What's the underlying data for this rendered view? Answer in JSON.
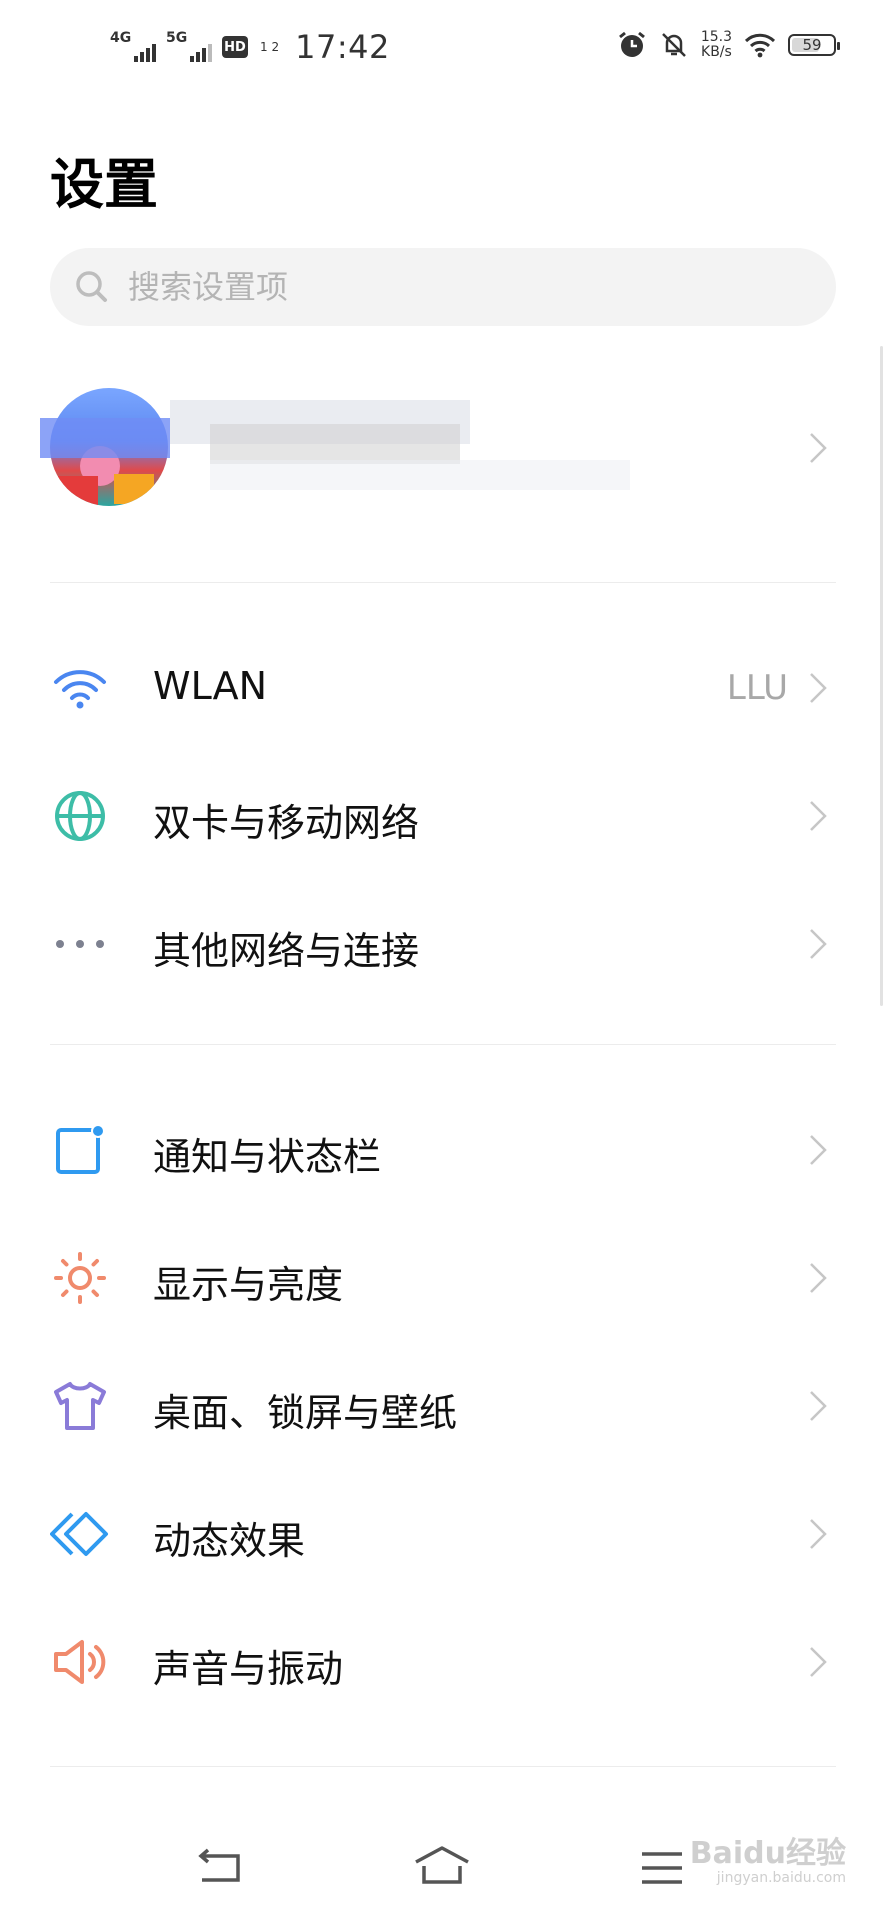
{
  "status_bar": {
    "sim1_type": "4G",
    "sim2_type": "5G",
    "hd_label": "HD",
    "hd_sub": "1 2",
    "time": "17:42",
    "net_speed_value": "15.3",
    "net_speed_unit": "KB/s",
    "battery_level": "59"
  },
  "page_title": "设置",
  "search": {
    "placeholder": "搜索设置项"
  },
  "account": {
    "name": "",
    "subtitle": ""
  },
  "sections": [
    {
      "items": [
        {
          "label": "WLAN",
          "value": "LLU",
          "icon": "wifi-icon",
          "color": "#4a86f0"
        },
        {
          "label": "双卡与移动网络",
          "value": "",
          "icon": "globe-icon",
          "color": "#3dbda7"
        },
        {
          "label": "其他网络与连接",
          "value": "",
          "icon": "more-dots-icon",
          "color": "#7d8190"
        }
      ]
    },
    {
      "items": [
        {
          "label": "通知与状态栏",
          "value": "",
          "icon": "notification-icon",
          "color": "#2f9af0"
        },
        {
          "label": "显示与亮度",
          "value": "",
          "icon": "sun-icon",
          "color": "#f08a6c"
        },
        {
          "label": "桌面、锁屏与壁纸",
          "value": "",
          "icon": "tshirt-icon",
          "color": "#8a7bd8"
        },
        {
          "label": "动态效果",
          "value": "",
          "icon": "diamond-icon",
          "color": "#2f9af0"
        },
        {
          "label": "声音与振动",
          "value": "",
          "icon": "speaker-icon",
          "color": "#f08a6c"
        }
      ]
    }
  ],
  "navbar": {
    "back": "back-icon",
    "home": "home-icon",
    "menu": "menu-icon"
  },
  "watermark": {
    "text": "Baidu经验",
    "sub": "jingyan.baidu.com"
  }
}
